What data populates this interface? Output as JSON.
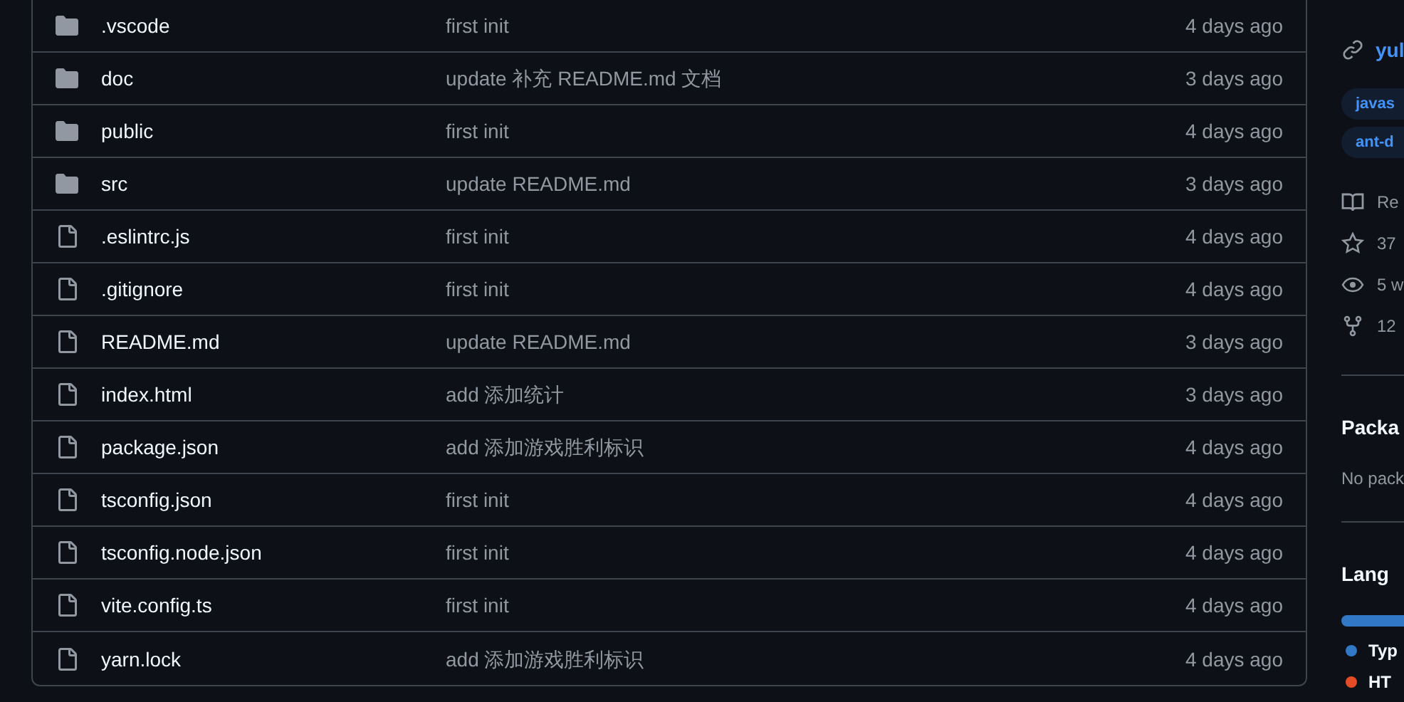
{
  "files": [
    {
      "kind": "folder",
      "name": ".vscode",
      "message": "first init",
      "age": "4 days ago"
    },
    {
      "kind": "folder",
      "name": "doc",
      "message": "update 补充 README.md 文档",
      "age": "3 days ago"
    },
    {
      "kind": "folder",
      "name": "public",
      "message": "first init",
      "age": "4 days ago"
    },
    {
      "kind": "folder",
      "name": "src",
      "message": "update README.md",
      "age": "3 days ago"
    },
    {
      "kind": "file",
      "name": ".eslintrc.js",
      "message": "first init",
      "age": "4 days ago"
    },
    {
      "kind": "file",
      "name": ".gitignore",
      "message": "first init",
      "age": "4 days ago"
    },
    {
      "kind": "file",
      "name": "README.md",
      "message": "update README.md",
      "age": "3 days ago"
    },
    {
      "kind": "file",
      "name": "index.html",
      "message": "add 添加统计",
      "age": "3 days ago"
    },
    {
      "kind": "file",
      "name": "package.json",
      "message": "add 添加游戏胜利标识",
      "age": "4 days ago"
    },
    {
      "kind": "file",
      "name": "tsconfig.json",
      "message": "first init",
      "age": "4 days ago"
    },
    {
      "kind": "file",
      "name": "tsconfig.node.json",
      "message": "first init",
      "age": "4 days ago"
    },
    {
      "kind": "file",
      "name": "vite.config.ts",
      "message": "first init",
      "age": "4 days ago"
    },
    {
      "kind": "file",
      "name": "yarn.lock",
      "message": "add 添加游戏胜利标识",
      "age": "4 days ago"
    }
  ],
  "sidebar": {
    "link": "yul",
    "topics": [
      "javas",
      "ant-d"
    ],
    "stats": [
      {
        "kind": "readme",
        "text": "Re"
      },
      {
        "kind": "stars",
        "text": "37"
      },
      {
        "kind": "watchers",
        "text": "5 w"
      },
      {
        "kind": "forks",
        "text": "12"
      }
    ],
    "packages": {
      "title": "Packa",
      "text": "No pack"
    },
    "languages": {
      "title": "Lang",
      "items": [
        {
          "name": "Typ",
          "color": "#3178c6"
        },
        {
          "name": "HT",
          "color": "#e34c26"
        }
      ]
    }
  }
}
